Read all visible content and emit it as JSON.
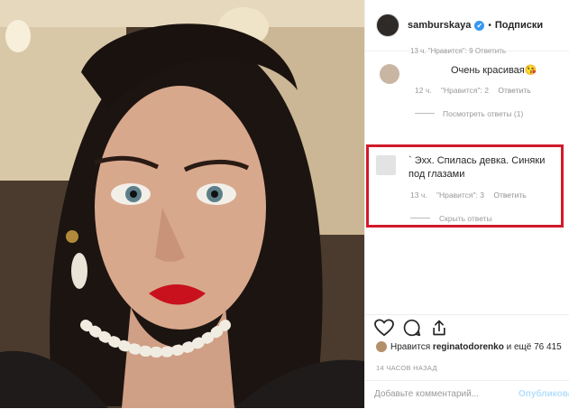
{
  "header": {
    "username": "samburskaya",
    "verified_glyph": "✔",
    "separator": "•",
    "follow_label": "Подписки"
  },
  "cut_comment": {
    "meta": "13 ч. \"Нравится\": 9  Ответить"
  },
  "comments": [
    {
      "text": "Очень красивая😘",
      "time": "12 ч.",
      "likes": "\"Нравится\": 2",
      "reply": "Ответить",
      "replies_toggle": "Посмотреть ответы (1)"
    },
    {
      "text": "` Эхх. Спилась девка. Синяки под глазами",
      "time": "13 ч.",
      "likes": "\"Нравится\": 3",
      "reply": "Ответить",
      "replies_toggle": "Скрыть ответы"
    }
  ],
  "highlight_color": "#d11a2a",
  "actions": {
    "like_icon": "heart-icon",
    "comment_icon": "comment-icon",
    "share_icon": "share-icon"
  },
  "likes": {
    "prefix": "Нравится",
    "user": "reginatodorenko",
    "suffix": "и ещё 76 415"
  },
  "timestamp": "14 ЧАСОВ НАЗАД",
  "add_comment": {
    "placeholder": "Добавьте комментарий...",
    "publish_label": "Опубликовать"
  }
}
